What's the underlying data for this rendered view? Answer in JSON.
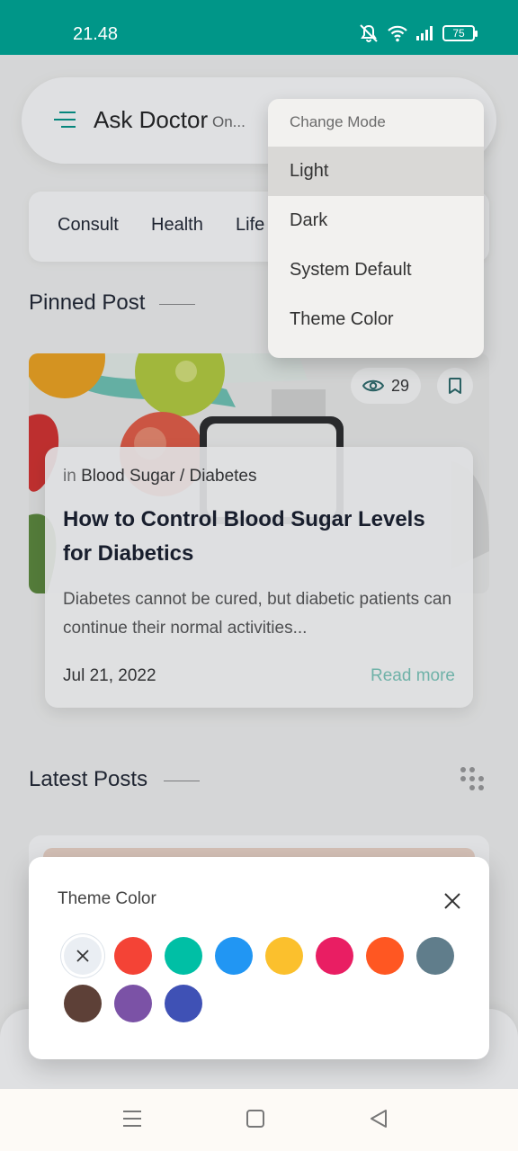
{
  "status_bar": {
    "time": "21.48",
    "battery": "75",
    "background": "#009688"
  },
  "header": {
    "title": "Ask Doctor",
    "subtitle": "On...",
    "menu_icon": "menu-icon"
  },
  "categories": [
    "Consult",
    "Health",
    "Life"
  ],
  "sections": {
    "pinned": "Pinned Post",
    "latest": "Latest Posts"
  },
  "pinned_post": {
    "views": "29",
    "category_prefix": "in",
    "category": "Blood Sugar / Diabetes",
    "title": "How to Control Blood Sugar Levels for Diabetics",
    "excerpt": "Diabetes cannot be cured, but diabetic patients can continue their normal activities...",
    "date": "Jul 21, 2022",
    "read_more": "Read more"
  },
  "mode_menu": {
    "header": "Change Mode",
    "items": [
      "Light",
      "Dark",
      "System Default",
      "Theme Color"
    ],
    "selected": "Light"
  },
  "theme_sheet": {
    "title": "Theme Color",
    "colors": [
      "#F44336",
      "#00BFA5",
      "#2196F3",
      "#FBC02D",
      "#E91E63",
      "#FF5722",
      "#607D8B",
      "#5D4037",
      "#7B52A6",
      "#3F51B5"
    ]
  },
  "accent": "#009688"
}
